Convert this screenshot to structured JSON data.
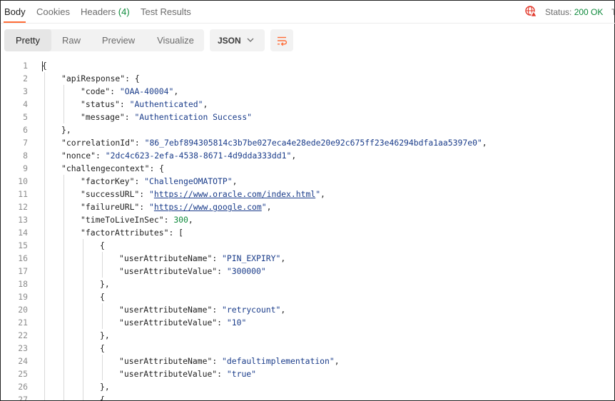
{
  "tabs": [
    {
      "label": "Body",
      "active": true
    },
    {
      "label": "Cookies",
      "active": false
    },
    {
      "label": "Headers",
      "count": "(4)",
      "active": false
    },
    {
      "label": "Test Results",
      "active": false
    }
  ],
  "status": {
    "label": "Status:",
    "value": "200 OK",
    "value_color": "#0f8a3c",
    "overflow_char": "T"
  },
  "view_modes": [
    "Pretty",
    "Raw",
    "Preview",
    "Visualize"
  ],
  "active_view": "Pretty",
  "format": {
    "selected": "JSON"
  },
  "accent_color": "#ff6c37",
  "lines": [
    {
      "n": "1",
      "indent": 0,
      "tokens": [
        [
          "p",
          "{"
        ]
      ]
    },
    {
      "n": "2",
      "indent": 1,
      "tokens": [
        [
          "k",
          "\"apiResponse\""
        ],
        [
          "p",
          ": {"
        ]
      ]
    },
    {
      "n": "3",
      "indent": 2,
      "tokens": [
        [
          "k",
          "\"code\""
        ],
        [
          "p",
          ": "
        ],
        [
          "s",
          "\"OAA-40004\""
        ],
        [
          "p",
          ","
        ]
      ]
    },
    {
      "n": "4",
      "indent": 2,
      "tokens": [
        [
          "k",
          "\"status\""
        ],
        [
          "p",
          ": "
        ],
        [
          "s",
          "\"Authenticated\""
        ],
        [
          "p",
          ","
        ]
      ]
    },
    {
      "n": "5",
      "indent": 2,
      "tokens": [
        [
          "k",
          "\"message\""
        ],
        [
          "p",
          ": "
        ],
        [
          "s",
          "\"Authentication Success\""
        ]
      ]
    },
    {
      "n": "6",
      "indent": 1,
      "tokens": [
        [
          "p",
          "},"
        ]
      ]
    },
    {
      "n": "7",
      "indent": 1,
      "tokens": [
        [
          "k",
          "\"correlationId\""
        ],
        [
          "p",
          ": "
        ],
        [
          "s",
          "\"86_7ebf894305814c3b7be027eca4e28ede20e92c675ff23e46294bdfa1aa5397e0\""
        ],
        [
          "p",
          ","
        ]
      ]
    },
    {
      "n": "8",
      "indent": 1,
      "tokens": [
        [
          "k",
          "\"nonce\""
        ],
        [
          "p",
          ": "
        ],
        [
          "s",
          "\"2dc4c623-2efa-4538-8671-4d9dda333dd1\""
        ],
        [
          "p",
          ","
        ]
      ]
    },
    {
      "n": "9",
      "indent": 1,
      "tokens": [
        [
          "k",
          "\"challengecontext\""
        ],
        [
          "p",
          ": {"
        ]
      ]
    },
    {
      "n": "10",
      "indent": 2,
      "tokens": [
        [
          "k",
          "\"factorKey\""
        ],
        [
          "p",
          ": "
        ],
        [
          "s",
          "\"ChallengeOMATOTP\""
        ],
        [
          "p",
          ","
        ]
      ]
    },
    {
      "n": "11",
      "indent": 2,
      "tokens": [
        [
          "k",
          "\"successURL\""
        ],
        [
          "p",
          ": "
        ],
        [
          "s",
          "\""
        ],
        [
          "link",
          "https://www.oracle.com/index.html"
        ],
        [
          "s",
          "\""
        ],
        [
          "p",
          ","
        ]
      ]
    },
    {
      "n": "12",
      "indent": 2,
      "tokens": [
        [
          "k",
          "\"failureURL\""
        ],
        [
          "p",
          ": "
        ],
        [
          "s",
          "\""
        ],
        [
          "link",
          "https://www.google.com"
        ],
        [
          "s",
          "\""
        ],
        [
          "p",
          ","
        ]
      ]
    },
    {
      "n": "13",
      "indent": 2,
      "tokens": [
        [
          "k",
          "\"timeToLiveInSec\""
        ],
        [
          "p",
          ": "
        ],
        [
          "n",
          "300"
        ],
        [
          "p",
          ","
        ]
      ]
    },
    {
      "n": "14",
      "indent": 2,
      "tokens": [
        [
          "k",
          "\"factorAttributes\""
        ],
        [
          "p",
          ": ["
        ]
      ]
    },
    {
      "n": "15",
      "indent": 3,
      "tokens": [
        [
          "p",
          "{"
        ]
      ]
    },
    {
      "n": "16",
      "indent": 4,
      "tokens": [
        [
          "k",
          "\"userAttributeName\""
        ],
        [
          "p",
          ": "
        ],
        [
          "s",
          "\"PIN_EXPIRY\""
        ],
        [
          "p",
          ","
        ]
      ]
    },
    {
      "n": "17",
      "indent": 4,
      "tokens": [
        [
          "k",
          "\"userAttributeValue\""
        ],
        [
          "p",
          ": "
        ],
        [
          "s",
          "\"300000\""
        ]
      ]
    },
    {
      "n": "18",
      "indent": 3,
      "tokens": [
        [
          "p",
          "},"
        ]
      ]
    },
    {
      "n": "19",
      "indent": 3,
      "tokens": [
        [
          "p",
          "{"
        ]
      ]
    },
    {
      "n": "20",
      "indent": 4,
      "tokens": [
        [
          "k",
          "\"userAttributeName\""
        ],
        [
          "p",
          ": "
        ],
        [
          "s",
          "\"retrycount\""
        ],
        [
          "p",
          ","
        ]
      ]
    },
    {
      "n": "21",
      "indent": 4,
      "tokens": [
        [
          "k",
          "\"userAttributeValue\""
        ],
        [
          "p",
          ": "
        ],
        [
          "s",
          "\"10\""
        ]
      ]
    },
    {
      "n": "22",
      "indent": 3,
      "tokens": [
        [
          "p",
          "},"
        ]
      ]
    },
    {
      "n": "23",
      "indent": 3,
      "tokens": [
        [
          "p",
          "{"
        ]
      ]
    },
    {
      "n": "24",
      "indent": 4,
      "tokens": [
        [
          "k",
          "\"userAttributeName\""
        ],
        [
          "p",
          ": "
        ],
        [
          "s",
          "\"defaultimplementation\""
        ],
        [
          "p",
          ","
        ]
      ]
    },
    {
      "n": "25",
      "indent": 4,
      "tokens": [
        [
          "k",
          "\"userAttributeValue\""
        ],
        [
          "p",
          ": "
        ],
        [
          "s",
          "\"true\""
        ]
      ]
    },
    {
      "n": "26",
      "indent": 3,
      "tokens": [
        [
          "p",
          "},"
        ]
      ]
    },
    {
      "n": "27",
      "indent": 3,
      "tokens": [
        [
          "p",
          "{"
        ]
      ]
    }
  ]
}
